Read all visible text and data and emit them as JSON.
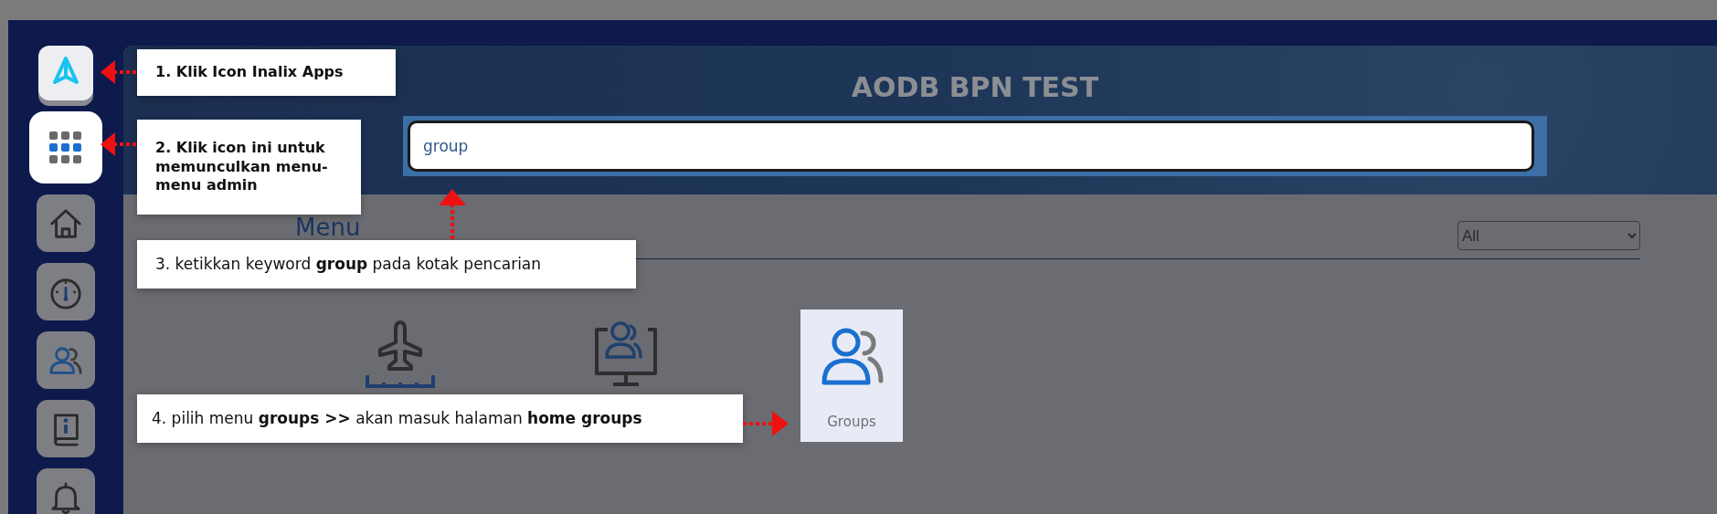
{
  "sidebar": {
    "items": [
      {
        "kind": "logo",
        "selected": false
      },
      {
        "kind": "apps",
        "selected": true
      },
      {
        "kind": "home",
        "selected": false
      },
      {
        "kind": "gauge",
        "selected": false
      },
      {
        "kind": "users",
        "selected": false
      },
      {
        "kind": "book",
        "selected": false
      },
      {
        "kind": "bell",
        "selected": false
      }
    ]
  },
  "header": {
    "title": "AODB BPN TEST"
  },
  "search": {
    "value": "group"
  },
  "menu": {
    "title": "Menu",
    "filter": "All",
    "items": [
      {
        "kind": "plane",
        "selected": false
      },
      {
        "kind": "monitor-users",
        "selected": false
      },
      {
        "kind": "users",
        "label": "Groups",
        "selected": true
      }
    ]
  },
  "callouts": [
    {
      "text": "1. Klik Icon Inalix Apps",
      "kind": "left"
    },
    {
      "text": "2. Klik icon ini untuk memunculkan menu-menu admin",
      "kind": "left"
    },
    {
      "text": "3. ketikkan keyword **group** pada kotak pencarian",
      "kind": "up"
    },
    {
      "text": "4. pilih menu **groups >>** akan masuk halaman **home groups**",
      "kind": "right"
    }
  ]
}
